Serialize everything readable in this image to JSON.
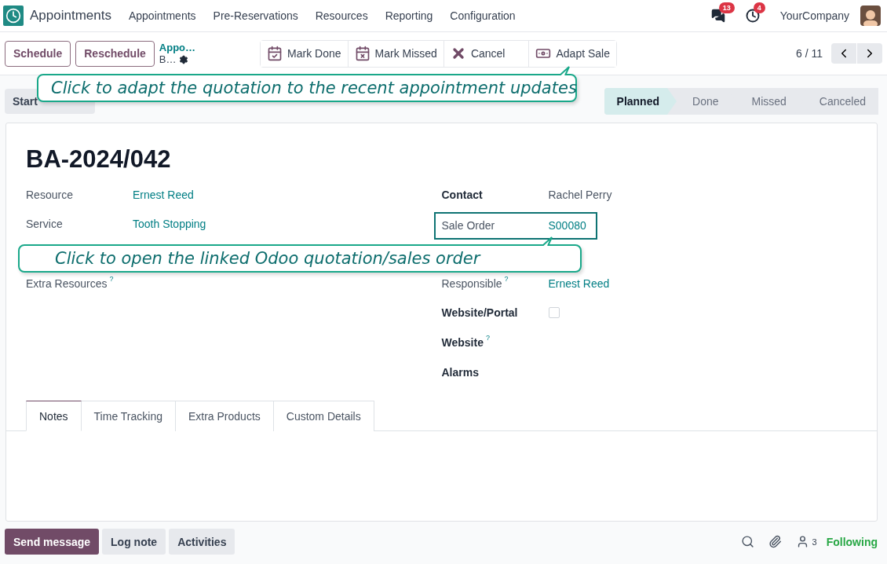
{
  "navbar": {
    "app_name": "Appointments",
    "menu": [
      "Appointments",
      "Pre-Reservations",
      "Resources",
      "Reporting",
      "Configuration"
    ],
    "messages_badge": "13",
    "activities_badge": "4",
    "company": "YourCompany"
  },
  "control_panel": {
    "buttons": [
      "Schedule",
      "Reschedule"
    ],
    "breadcrumb": {
      "parent": "Appo…",
      "current": "B…"
    },
    "actions": [
      {
        "label": "Mark Done",
        "kind": "done"
      },
      {
        "label": "Mark Missed",
        "kind": "missed"
      },
      {
        "label": "Cancel",
        "kind": "cancel"
      },
      {
        "label": "Adapt Sale",
        "kind": "sale"
      }
    ],
    "pager": "6 / 11"
  },
  "header": {
    "buttons": [
      "Start"
    ],
    "stages": [
      {
        "label": "Planned",
        "selected": true
      },
      {
        "label": "Done",
        "selected": false
      },
      {
        "label": "Missed",
        "selected": false
      },
      {
        "label": "Canceled",
        "selected": false
      }
    ]
  },
  "record": {
    "title": "BA-2024/042",
    "left_fields": [
      {
        "label": "Resource",
        "value": "Ernest Reed",
        "kind": "link",
        "strong": false
      },
      {
        "label": "Service",
        "value": "Tooth Stopping",
        "kind": "link",
        "strong": false
      },
      {
        "kind": "hidden"
      },
      {
        "label": "Extra Resources",
        "kind": "empty",
        "strong": false,
        "help": "?"
      }
    ],
    "right_fields": [
      {
        "label": "Contact",
        "value": "Rachel Perry",
        "kind": "text",
        "strong": true
      },
      {
        "label": "Sale Order",
        "value": "S00080",
        "kind": "link",
        "strong": false,
        "highlighted": true
      },
      {
        "kind": "hidden"
      },
      {
        "label": "Responsible",
        "value": "Ernest Reed",
        "kind": "link",
        "strong": false,
        "help": "?"
      },
      {
        "label": "Website/Portal",
        "kind": "checkbox",
        "checked": false,
        "strong": true
      },
      {
        "label": "Website",
        "kind": "empty",
        "strong": true,
        "help": "?"
      },
      {
        "label": "Alarms",
        "kind": "empty",
        "strong": true
      }
    ]
  },
  "tabs": [
    {
      "label": "Notes",
      "selected": true
    },
    {
      "label": "Time Tracking",
      "selected": false
    },
    {
      "label": "Extra Products",
      "selected": false
    },
    {
      "label": "Custom Details",
      "selected": false
    }
  ],
  "chatter": {
    "buttons": [
      {
        "label": "Send message",
        "primary": true
      },
      {
        "label": "Log note",
        "primary": false
      },
      {
        "label": "Activities",
        "primary": false
      }
    ],
    "followers_count": "3",
    "follow_label": "Following"
  },
  "callouts": [
    {
      "text": "Click to adapt the quotation to the recent appointment updates"
    },
    {
      "text": "Click to open the linked Odoo quotation/sales order"
    }
  ]
}
